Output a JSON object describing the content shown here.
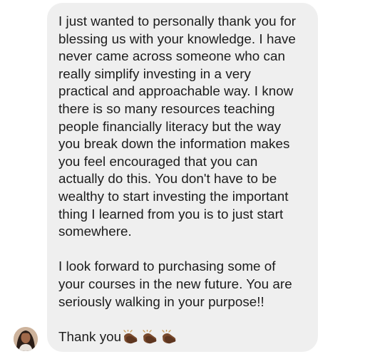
{
  "message": {
    "paragraph_1": "I just wanted to personally thank you for\nblessing us with your knowledge. I have\nnever came across someone who can\nreally simplify investing in a very\npractical and approachable way. I know\nthere is so many resources teaching\npeople financially literacy but the way\nyou break down the information  makes\nyou feel encouraged that you can\nactually do this. You don't have to be\nwealthy to start investing the important\nthing I learned from you is to just start\nsomewhere.",
    "paragraph_2": "I look forward to purchasing some of\nyour courses in the new future. You are\nseriously walking in your purpose!!",
    "closing": "Thank you",
    "closing_emoji": [
      "clapping-hands-icon",
      "clapping-hands-icon",
      "clapping-hands-icon"
    ]
  },
  "colors": {
    "bubble_background": "#efefef",
    "text": "#1c1c1c",
    "emoji_skin": "#7a4a2c"
  },
  "sender": {
    "avatar_icon": "profile-photo"
  }
}
